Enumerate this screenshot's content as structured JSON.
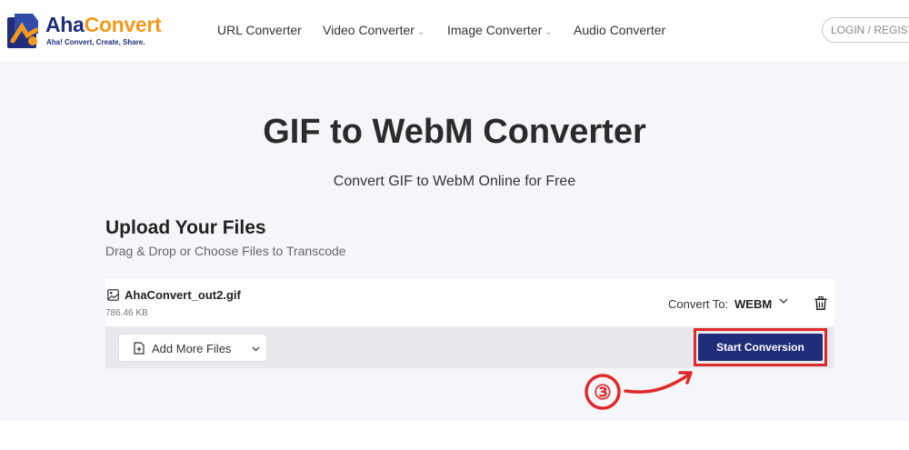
{
  "header": {
    "logo": {
      "name_part1": "Aha",
      "name_part2": "Convert",
      "tagline": "Aha! Convert, Create, Share."
    },
    "nav": [
      {
        "label": "URL Converter",
        "has_dropdown": false
      },
      {
        "label": "Video Converter",
        "has_dropdown": true
      },
      {
        "label": "Image Converter",
        "has_dropdown": true
      },
      {
        "label": "Audio Converter",
        "has_dropdown": false
      }
    ],
    "login_label": "LOGIN / REGIST"
  },
  "hero": {
    "title": "GIF to WebM Converter",
    "subtitle": "Convert GIF to WebM Online for Free"
  },
  "upload": {
    "title": "Upload Your Files",
    "subtitle": "Drag & Drop or Choose Files to Transcode",
    "file": {
      "name": "AhaConvert_out2.gif",
      "size": "786.46 KB",
      "icon": "image-file-icon"
    },
    "convert_to_label": "Convert To:",
    "convert_to_value": "WEBM",
    "add_more_label": "Add More Files",
    "start_label": "Start Conversion"
  },
  "annotation": {
    "step_number": "③",
    "highlight_color": "#e02a2a"
  },
  "colors": {
    "brand_navy": "#1f2d7a",
    "brand_orange": "#f39a1b",
    "hero_bg": "#f4f6fa",
    "bar_bg": "#e8e9ee"
  }
}
